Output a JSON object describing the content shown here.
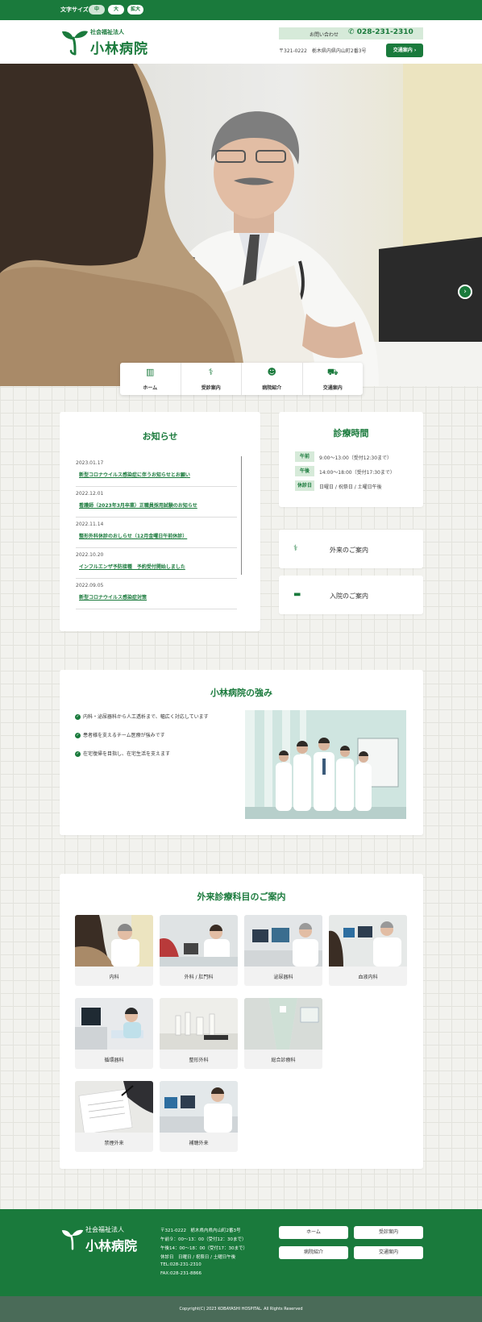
{
  "topbar": {
    "font_size_label": "文字サイズ",
    "sizes": [
      "中",
      "大",
      "拡大"
    ],
    "active_size": "中"
  },
  "header": {
    "logo_sub": "社会福祉法人",
    "logo_main": "小林病院",
    "contact_label": "お問い合わせ",
    "contact_tel": "028-231-2310",
    "address": "〒321-0222　栃木県内県内山町2番3号",
    "access_button": "交通案内"
  },
  "quick_nav": [
    {
      "icon": "building-icon",
      "label": "ホーム"
    },
    {
      "icon": "stethoscope-icon",
      "label": "受診案内"
    },
    {
      "icon": "doctor-icon",
      "label": "病院紹介"
    },
    {
      "icon": "car-icon",
      "label": "交通案内"
    }
  ],
  "news": {
    "title": "お知らせ",
    "items": [
      {
        "date": "2023.01.17",
        "text": "新型コロナウイルス感染症に伴うお知らせとお願い"
      },
      {
        "date": "2022.12.01",
        "text": "看護師（2023年3月卒業）正職員採用試験のお知らせ"
      },
      {
        "date": "2022.11.14",
        "text": "整形外科休診のおしらせ（12月金曜日午前休診）"
      },
      {
        "date": "2022.10.20",
        "text": "インフルエンザ予防接種　予約受付開始しました"
      },
      {
        "date": "2022.09.05",
        "text": "新型コロナウイルス感染症対策"
      }
    ]
  },
  "hours": {
    "title": "診療時間",
    "rows": [
      {
        "tag": "午前",
        "text": "9:00〜13:00（受付12:30まで）"
      },
      {
        "tag": "午後",
        "text": "14:00〜18:00（受付17:30まで）"
      },
      {
        "tag": "休診日",
        "text": "日曜日 / 祝祭日 / 土曜日午後"
      }
    ]
  },
  "guides": [
    {
      "icon": "stethoscope-icon",
      "label": "外来のご案内"
    },
    {
      "icon": "bed-icon",
      "label": "入院のご案内"
    }
  ],
  "strengths": {
    "title": "小林病院の強み",
    "items": [
      "内科・泌尿器科から人工透析まで、幅広く対応しています",
      "患者様を支えるチーム医療が強みです",
      "在宅復帰を目指し、在宅生活を支えます"
    ]
  },
  "departments": {
    "title": "外来診療科目のご案内",
    "items": [
      "内科",
      "外科 / 肛門科",
      "泌尿器科",
      "血液内科",
      "循環器科",
      "整形外科",
      "総合診療科",
      "禁煙外来",
      "補聴外来"
    ]
  },
  "footer": {
    "logo_sub": "社会福祉法人",
    "logo_main": "小林病院",
    "info": [
      "〒321-0222　栃木県内県内山町2番3号",
      "午前９：00〜13：00（受付12：30まで）",
      "午後14：00〜18：00（受付17：30まで）",
      "休診日　日曜日 / 祝祭日 / 土曜日午後",
      "TEL:028-231-2310",
      "FAX:028-231-8866"
    ],
    "buttons": [
      "ホーム",
      "受診案内",
      "病院紹介",
      "交通案内"
    ],
    "copyright": "Copyright(C) 2023 KOBAYASHI HOSPITAL. All Rights Reserved"
  },
  "colors": {
    "brand": "#1a7a3c",
    "brand_light": "#d6ead9",
    "footer_bottom": "#4a6b58"
  }
}
